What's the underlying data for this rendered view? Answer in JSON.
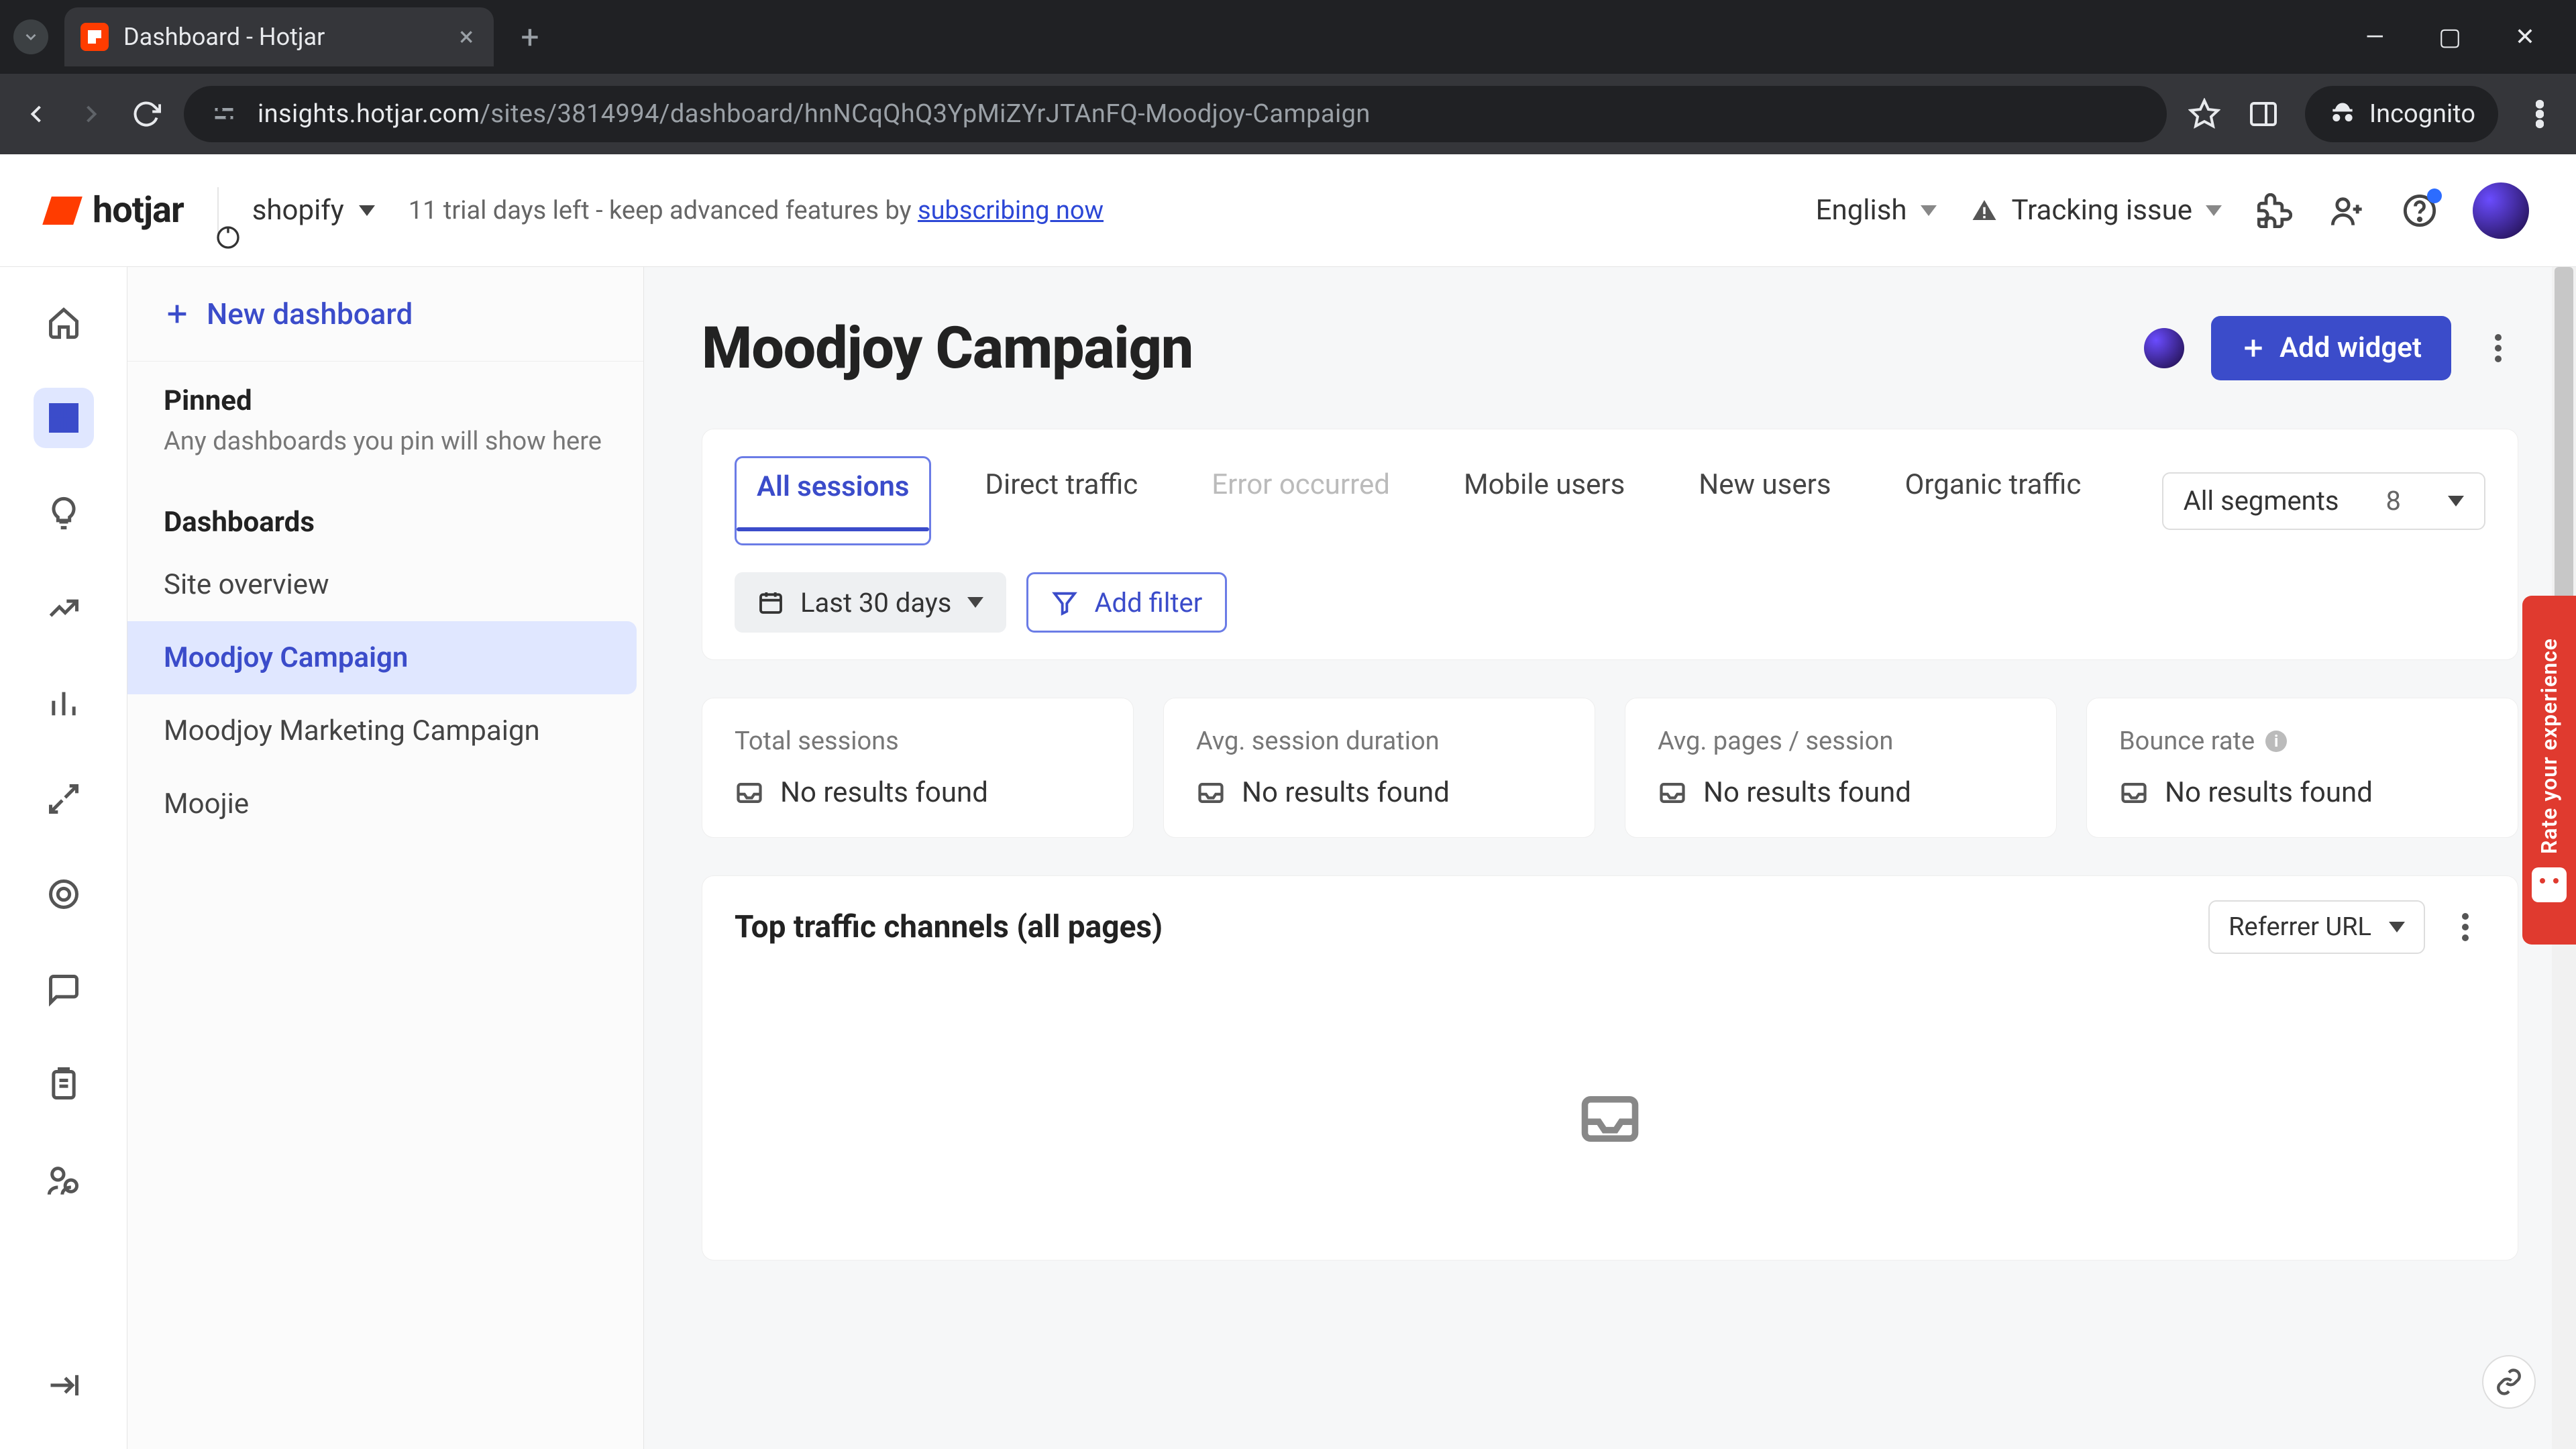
{
  "browser": {
    "tab_title": "Dashboard - Hotjar",
    "url_host": "insights.hotjar.com",
    "url_path": "/sites/3814994/dashboard/hnNCqQhQ3YpMiZYrJTAnFQ-Moodjoy-Campaign",
    "incognito_label": "Incognito"
  },
  "header": {
    "logo_text": "hotjar",
    "site_name": "shopify",
    "trial_prefix": "11 trial days left - keep advanced features by ",
    "trial_link": "subscribing now",
    "language": "English",
    "tracking_label": "Tracking issue"
  },
  "sidebar": {
    "new_dashboard": "New dashboard",
    "pinned_heading": "Pinned",
    "pinned_hint": "Any dashboards you pin will show here",
    "dashboards_heading": "Dashboards",
    "items": [
      {
        "label": "Site overview",
        "active": false
      },
      {
        "label": "Moodjoy Campaign",
        "active": true
      },
      {
        "label": "Moodjoy Marketing Campaign",
        "active": false
      },
      {
        "label": "Moojie",
        "active": false
      }
    ]
  },
  "page": {
    "title": "Moodjoy Campaign",
    "add_widget": "Add widget"
  },
  "segments": {
    "tabs": [
      {
        "label": "All sessions",
        "state": "active"
      },
      {
        "label": "Direct traffic",
        "state": "normal"
      },
      {
        "label": "Error occurred",
        "state": "muted"
      },
      {
        "label": "Mobile users",
        "state": "normal"
      },
      {
        "label": "New users",
        "state": "normal"
      },
      {
        "label": "Organic traffic",
        "state": "normal"
      }
    ],
    "dropdown_label": "All segments",
    "dropdown_count": "8"
  },
  "filters": {
    "date_label": "Last 30 days",
    "add_filter": "Add filter"
  },
  "stats": [
    {
      "label": "Total sessions",
      "value": "No results found",
      "info": false
    },
    {
      "label": "Avg. session duration",
      "value": "No results found",
      "info": false
    },
    {
      "label": "Avg. pages / session",
      "value": "No results found",
      "info": false
    },
    {
      "label": "Bounce rate",
      "value": "No results found",
      "info": true
    }
  ],
  "widget": {
    "title": "Top traffic channels (all pages)",
    "dropdown": "Referrer URL"
  },
  "feedback_tab": "Rate your experience"
}
